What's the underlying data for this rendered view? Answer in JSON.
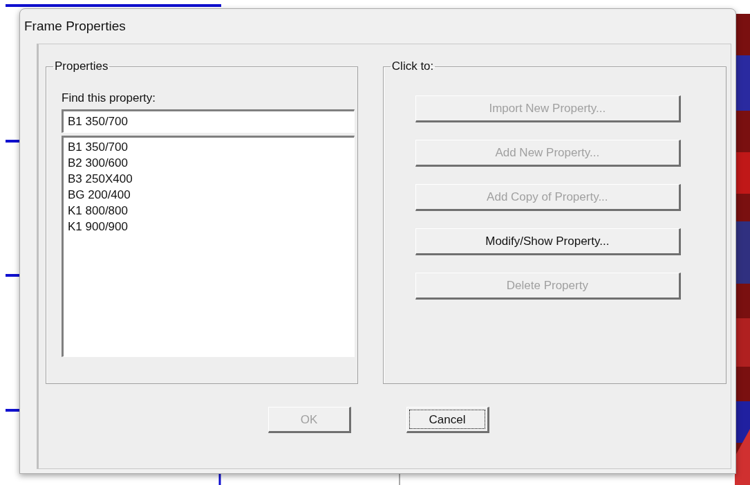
{
  "window": {
    "title": "Frame Properties"
  },
  "properties_group": {
    "legend": "Properties",
    "find_label": "Find this property:",
    "search": {
      "value": "B1 350/700"
    },
    "items": [
      {
        "label": "B1 350/700",
        "selected": false
      },
      {
        "label": "B2 300/600",
        "selected": false
      },
      {
        "label": "B3 250X400",
        "selected": false
      },
      {
        "label": "BG 200/400",
        "selected": false
      },
      {
        "label": "K1 800/800",
        "selected": false
      },
      {
        "label": "K1 900/900",
        "selected": false
      }
    ]
  },
  "actions_group": {
    "legend": "Click to:",
    "buttons": [
      {
        "label": "Import New Property...",
        "disabled": true
      },
      {
        "label": "Add New Property...",
        "disabled": true
      },
      {
        "label": "Add Copy of Property...",
        "disabled": true
      },
      {
        "label": "Modify/Show Property...",
        "disabled": false
      },
      {
        "label": "Delete Property",
        "disabled": true
      }
    ]
  },
  "dialog_buttons": [
    {
      "label": "OK",
      "disabled": true,
      "focused": false
    },
    {
      "label": "Cancel",
      "disabled": false,
      "focused": true
    }
  ]
}
